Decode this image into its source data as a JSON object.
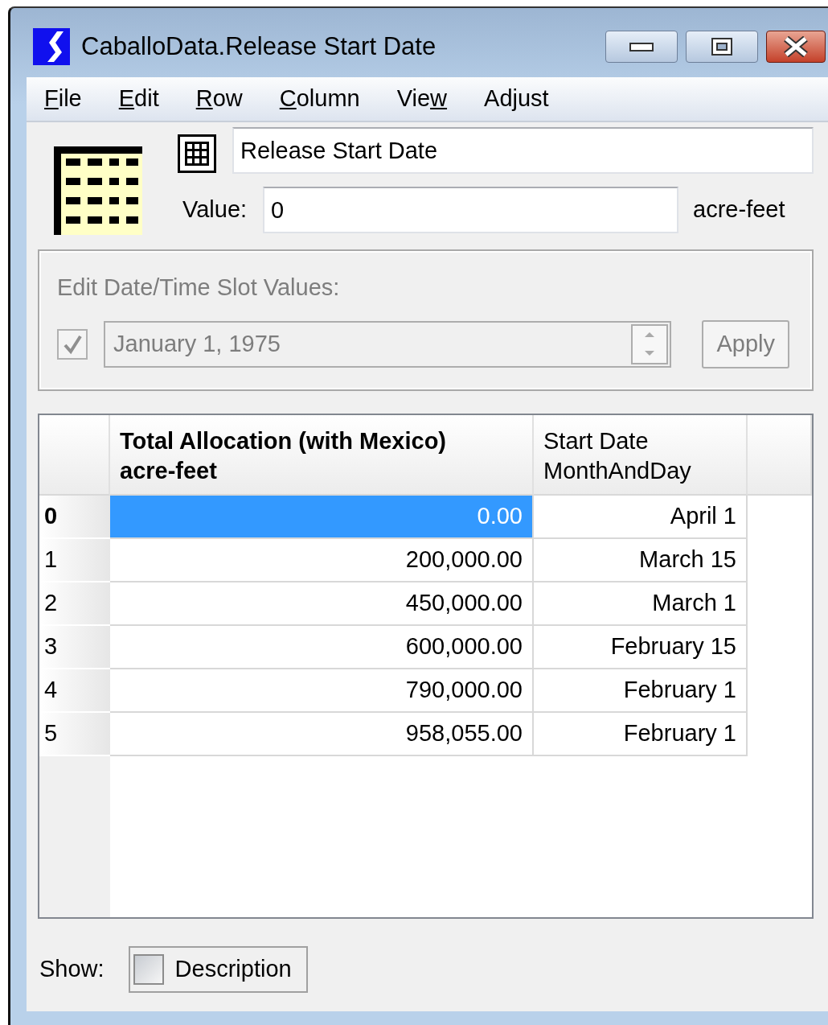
{
  "window": {
    "title": "CaballoData.Release Start Date"
  },
  "menu": [
    {
      "key": "F",
      "after": "ile"
    },
    {
      "key": "E",
      "after": "dit"
    },
    {
      "key": "R",
      "after": "ow"
    },
    {
      "key": "C",
      "after": "olumn"
    },
    {
      "before": "Vie",
      "key": "w"
    },
    {
      "before": "Ad",
      "key": "j",
      "after": "ust"
    }
  ],
  "slot": {
    "name": "Release Start Date",
    "value_label": "Value:",
    "value": "0",
    "units": "acre-feet"
  },
  "date_group": {
    "title": "Edit Date/Time Slot Values:",
    "disabled": true,
    "checked": true,
    "date": "January 1, 1975",
    "apply": "Apply"
  },
  "table": {
    "columns": [
      {
        "title": "Total Allocation (with Mexico)",
        "units": "acre-feet",
        "bold": true
      },
      {
        "title": "Start Date",
        "units": "MonthAndDay",
        "bold": false
      }
    ],
    "rows": [
      {
        "index": "0",
        "selected": true,
        "cells": [
          "0.00",
          "April 1"
        ]
      },
      {
        "index": "1",
        "selected": false,
        "cells": [
          "200,000.00",
          "March 15"
        ]
      },
      {
        "index": "2",
        "selected": false,
        "cells": [
          "450,000.00",
          "March 1"
        ]
      },
      {
        "index": "3",
        "selected": false,
        "cells": [
          "600,000.00",
          "February 15"
        ]
      },
      {
        "index": "4",
        "selected": false,
        "cells": [
          "790,000.00",
          "February 1"
        ]
      },
      {
        "index": "5",
        "selected": false,
        "cells": [
          "958,055.00",
          "February 1"
        ]
      }
    ]
  },
  "footer": {
    "label": "Show:",
    "option": "Description",
    "checked": false
  }
}
